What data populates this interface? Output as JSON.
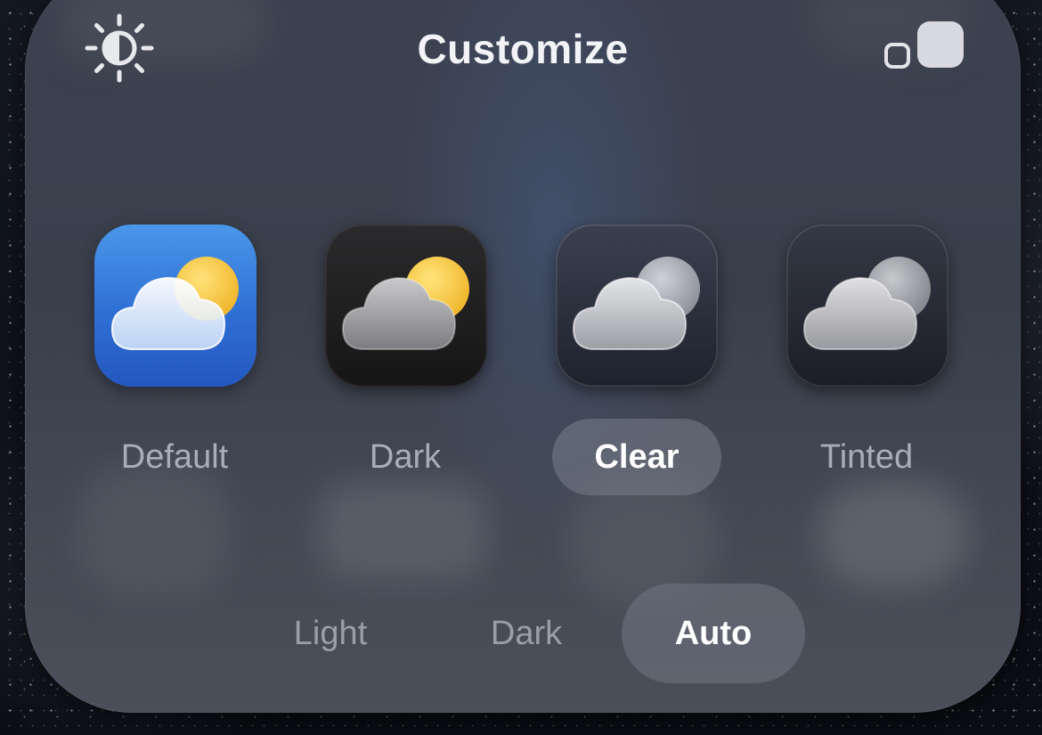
{
  "header": {
    "title": "Customize",
    "brightness_icon": "sun-half-icon",
    "size_toggle_icon": "icon-size-toggle-icon"
  },
  "icon_styles": [
    {
      "label": "Default",
      "icon": "weather-app-icon",
      "selected": false
    },
    {
      "label": "Dark",
      "icon": "weather-app-icon",
      "selected": false
    },
    {
      "label": "Clear",
      "icon": "weather-app-icon",
      "selected": true
    },
    {
      "label": "Tinted",
      "icon": "weather-app-icon",
      "selected": false
    }
  ],
  "appearance_modes": [
    {
      "label": "Light",
      "selected": false
    },
    {
      "label": "Dark",
      "selected": false
    },
    {
      "label": "Auto",
      "selected": true
    }
  ],
  "colors": {
    "panel": "#3c4150",
    "selected_pill": "#787d8a",
    "title_text": "#f2f3f6",
    "unselected_text": "#a9adb7",
    "default_tile": "#3a7fe0",
    "sun_yellow": "#f3c94a"
  }
}
